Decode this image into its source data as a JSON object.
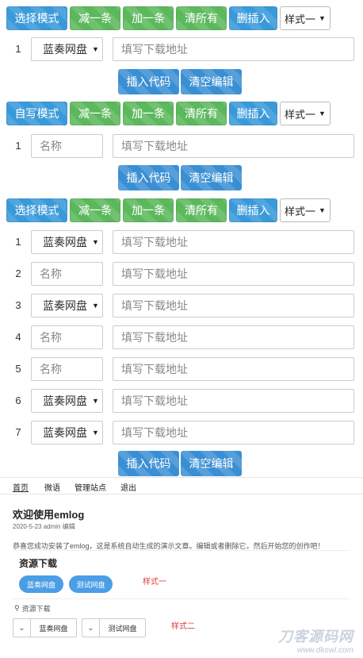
{
  "section1": {
    "toolbar": {
      "mode": "选择模式",
      "minus": "减一条",
      "plus": "加一条",
      "clear_all": "清所有",
      "del_insert": "删插入",
      "style_select": "样式一"
    },
    "rows": [
      {
        "num": "1",
        "type": "select",
        "first": "蓝奏网盘",
        "url_placeholder": "填写下载地址"
      }
    ],
    "actions": {
      "insert": "插入代码",
      "clear": "清空编辑"
    }
  },
  "section2": {
    "toolbar": {
      "mode": "自写模式",
      "minus": "减一条",
      "plus": "加一条",
      "clear_all": "清所有",
      "del_insert": "删插入",
      "style_select": "样式一"
    },
    "rows": [
      {
        "num": "1",
        "type": "name",
        "first": "名称",
        "url_placeholder": "填写下载地址"
      }
    ],
    "actions": {
      "insert": "插入代码",
      "clear": "清空编辑"
    }
  },
  "section3": {
    "toolbar": {
      "mode": "选择模式",
      "minus": "减一条",
      "plus": "加一条",
      "clear_all": "清所有",
      "del_insert": "删插入",
      "style_select": "样式一"
    },
    "rows": [
      {
        "num": "1",
        "type": "select",
        "first": "蓝奏网盘",
        "url_placeholder": "填写下载地址"
      },
      {
        "num": "2",
        "type": "name",
        "first": "名称",
        "url_placeholder": "填写下载地址"
      },
      {
        "num": "3",
        "type": "select",
        "first": "蓝奏网盘",
        "url_placeholder": "填写下载地址"
      },
      {
        "num": "4",
        "type": "name",
        "first": "名称",
        "url_placeholder": "填写下载地址"
      },
      {
        "num": "5",
        "type": "name",
        "first": "名称",
        "url_placeholder": "填写下载地址"
      },
      {
        "num": "6",
        "type": "select",
        "first": "蓝奏网盘",
        "url_placeholder": "填写下载地址"
      },
      {
        "num": "7",
        "type": "select",
        "first": "蓝奏网盘",
        "url_placeholder": "填写下载地址"
      }
    ],
    "actions": {
      "insert": "插入代码",
      "clear": "清空编辑"
    }
  },
  "blog": {
    "nav": [
      "首页",
      "微语",
      "管理站点",
      "退出"
    ],
    "post_title": "欢迎使用emlog",
    "post_meta": "2020-5-23 admin 编辑",
    "post_body": "恭喜您成功安装了emlog，这是系统自动生成的演示文章。编辑或者删除它，然后开始您的创作吧！",
    "download_title": "资源下载",
    "style1_buttons": [
      "蓝奏网盘",
      "测试网盘"
    ],
    "style1_note": "样式一",
    "style2_label": "资源下载",
    "style2_buttons": [
      "蓝奏网盘",
      "测试网盘"
    ],
    "style2_note": "样式二"
  },
  "watermark": {
    "big": "刀客源码网",
    "small": "www.dkewl.com"
  },
  "colors": {
    "blue_button": "#3a9ad9",
    "green_button": "#5cb85c",
    "action_button": "#3a8fd4",
    "pill": "#4a9ee6",
    "note_red": "#e43b3b"
  },
  "icons": {
    "caret": "caret-down-icon",
    "attachment": "paperclip-icon",
    "chevron": "chevron-down-icon"
  }
}
